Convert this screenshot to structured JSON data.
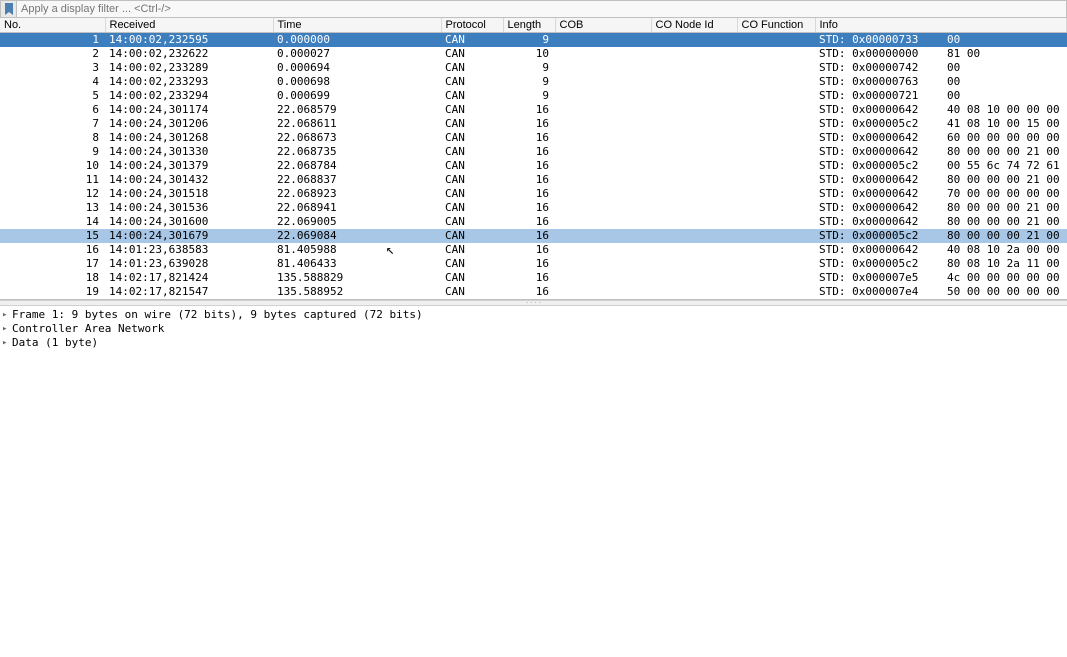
{
  "filter": {
    "placeholder": "Apply a display filter ... <Ctrl-/>"
  },
  "columns": {
    "no": "No.",
    "received": "Received",
    "time": "Time",
    "protocol": "Protocol",
    "length": "Length",
    "cob": "COB",
    "co_node_id": "CO Node Id",
    "co_function": "CO Function",
    "info": "Info"
  },
  "packets": [
    {
      "no": "1",
      "recv": "14:00:02,232595",
      "time": "0.000000",
      "proto": "CAN",
      "len": "9",
      "cob": "",
      "conode": "",
      "cofunc": "",
      "info_std": "STD: 0x00000733",
      "info_data": "00",
      "sel": true
    },
    {
      "no": "2",
      "recv": "14:00:02,232622",
      "time": "0.000027",
      "proto": "CAN",
      "len": "10",
      "cob": "",
      "conode": "",
      "cofunc": "",
      "info_std": "STD: 0x00000000",
      "info_data": "81 00"
    },
    {
      "no": "3",
      "recv": "14:00:02,233289",
      "time": "0.000694",
      "proto": "CAN",
      "len": "9",
      "cob": "",
      "conode": "",
      "cofunc": "",
      "info_std": "STD: 0x00000742",
      "info_data": "00"
    },
    {
      "no": "4",
      "recv": "14:00:02,233293",
      "time": "0.000698",
      "proto": "CAN",
      "len": "9",
      "cob": "",
      "conode": "",
      "cofunc": "",
      "info_std": "STD: 0x00000763",
      "info_data": "00"
    },
    {
      "no": "5",
      "recv": "14:00:02,233294",
      "time": "0.000699",
      "proto": "CAN",
      "len": "9",
      "cob": "",
      "conode": "",
      "cofunc": "",
      "info_std": "STD: 0x00000721",
      "info_data": "00"
    },
    {
      "no": "6",
      "recv": "14:00:24,301174",
      "time": "22.068579",
      "proto": "CAN",
      "len": "16",
      "cob": "",
      "conode": "",
      "cofunc": "",
      "info_std": "STD: 0x00000642",
      "info_data": "40 08 10 00 00 00"
    },
    {
      "no": "7",
      "recv": "14:00:24,301206",
      "time": "22.068611",
      "proto": "CAN",
      "len": "16",
      "cob": "",
      "conode": "",
      "cofunc": "",
      "info_std": "STD: 0x000005c2",
      "info_data": "41 08 10 00 15 00"
    },
    {
      "no": "8",
      "recv": "14:00:24,301268",
      "time": "22.068673",
      "proto": "CAN",
      "len": "16",
      "cob": "",
      "conode": "",
      "cofunc": "",
      "info_std": "STD: 0x00000642",
      "info_data": "60 00 00 00 00 00"
    },
    {
      "no": "9",
      "recv": "14:00:24,301330",
      "time": "22.068735",
      "proto": "CAN",
      "len": "16",
      "cob": "",
      "conode": "",
      "cofunc": "",
      "info_std": "STD: 0x00000642",
      "info_data": "80 00 00 00 21 00"
    },
    {
      "no": "10",
      "recv": "14:00:24,301379",
      "time": "22.068784",
      "proto": "CAN",
      "len": "16",
      "cob": "",
      "conode": "",
      "cofunc": "",
      "info_std": "STD: 0x000005c2",
      "info_data": "00 55 6c 74 72 61"
    },
    {
      "no": "11",
      "recv": "14:00:24,301432",
      "time": "22.068837",
      "proto": "CAN",
      "len": "16",
      "cob": "",
      "conode": "",
      "cofunc": "",
      "info_std": "STD: 0x00000642",
      "info_data": "80 00 00 00 21 00"
    },
    {
      "no": "12",
      "recv": "14:00:24,301518",
      "time": "22.068923",
      "proto": "CAN",
      "len": "16",
      "cob": "",
      "conode": "",
      "cofunc": "",
      "info_std": "STD: 0x00000642",
      "info_data": "70 00 00 00 00 00"
    },
    {
      "no": "13",
      "recv": "14:00:24,301536",
      "time": "22.068941",
      "proto": "CAN",
      "len": "16",
      "cob": "",
      "conode": "",
      "cofunc": "",
      "info_std": "STD: 0x00000642",
      "info_data": "80 00 00 00 21 00"
    },
    {
      "no": "14",
      "recv": "14:00:24,301600",
      "time": "22.069005",
      "proto": "CAN",
      "len": "16",
      "cob": "",
      "conode": "",
      "cofunc": "",
      "info_std": "STD: 0x00000642",
      "info_data": "80 00 00 00 21 00"
    },
    {
      "no": "15",
      "recv": "14:00:24,301679",
      "time": "22.069084",
      "proto": "CAN",
      "len": "16",
      "cob": "",
      "conode": "",
      "cofunc": "",
      "info_std": "STD: 0x000005c2",
      "info_data": "80 00 00 00 21 00",
      "rel": true
    },
    {
      "no": "16",
      "recv": "14:01:23,638583",
      "time": "81.405988",
      "proto": "CAN",
      "len": "16",
      "cob": "",
      "conode": "",
      "cofunc": "",
      "info_std": "STD: 0x00000642",
      "info_data": "40 08 10 2a 00 00"
    },
    {
      "no": "17",
      "recv": "14:01:23,639028",
      "time": "81.406433",
      "proto": "CAN",
      "len": "16",
      "cob": "",
      "conode": "",
      "cofunc": "",
      "info_std": "STD: 0x000005c2",
      "info_data": "80 08 10 2a 11 00"
    },
    {
      "no": "18",
      "recv": "14:02:17,821424",
      "time": "135.588829",
      "proto": "CAN",
      "len": "16",
      "cob": "",
      "conode": "",
      "cofunc": "",
      "info_std": "STD: 0x000007e5",
      "info_data": "4c 00 00 00 00 00"
    },
    {
      "no": "19",
      "recv": "14:02:17,821547",
      "time": "135.588952",
      "proto": "CAN",
      "len": "16",
      "cob": "",
      "conode": "",
      "cofunc": "",
      "info_std": "STD: 0x000007e4",
      "info_data": "50 00 00 00 00 00"
    }
  ],
  "details": [
    "Frame 1: 9 bytes on wire (72 bits), 9 bytes captured (72 bits)",
    "Controller Area Network",
    "Data (1 byte)"
  ]
}
